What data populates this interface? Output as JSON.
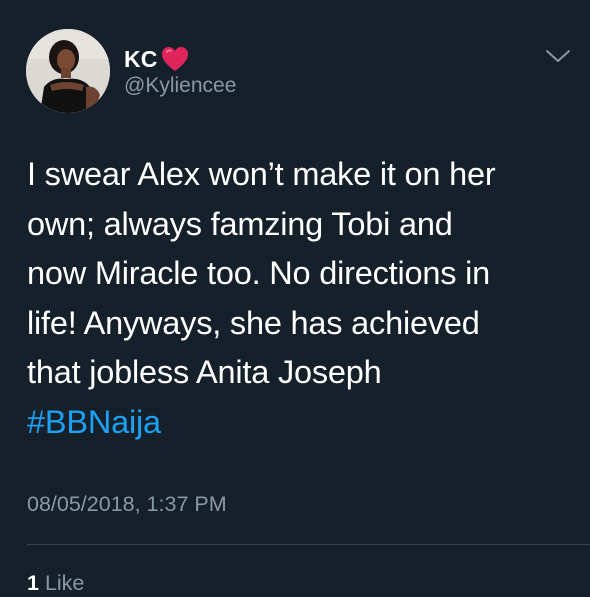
{
  "tweet": {
    "display_name": "KC",
    "handle": "@Kyliencee",
    "text_lines": [
      "I swear Alex won’t make it on her",
      "own; always famzing Tobi and",
      "now Miracle too. No directions in",
      "life! Anyways, she has achieved",
      "that jobless Anita Joseph"
    ],
    "hashtag": "#BBNaija",
    "timestamp": "08/05/2018, 1:37 PM",
    "likes_count": "1",
    "likes_label": "Like"
  },
  "icons": {
    "name_emoji": "red-heart-icon",
    "menu": "chevron-down-icon",
    "avatar": "avatar"
  },
  "colors": {
    "background": "#15202b",
    "primary_text": "#ffffff",
    "secondary_text": "#8899a6",
    "link": "#1da1f2",
    "divider": "#38444d",
    "heart": "#e0245e"
  }
}
